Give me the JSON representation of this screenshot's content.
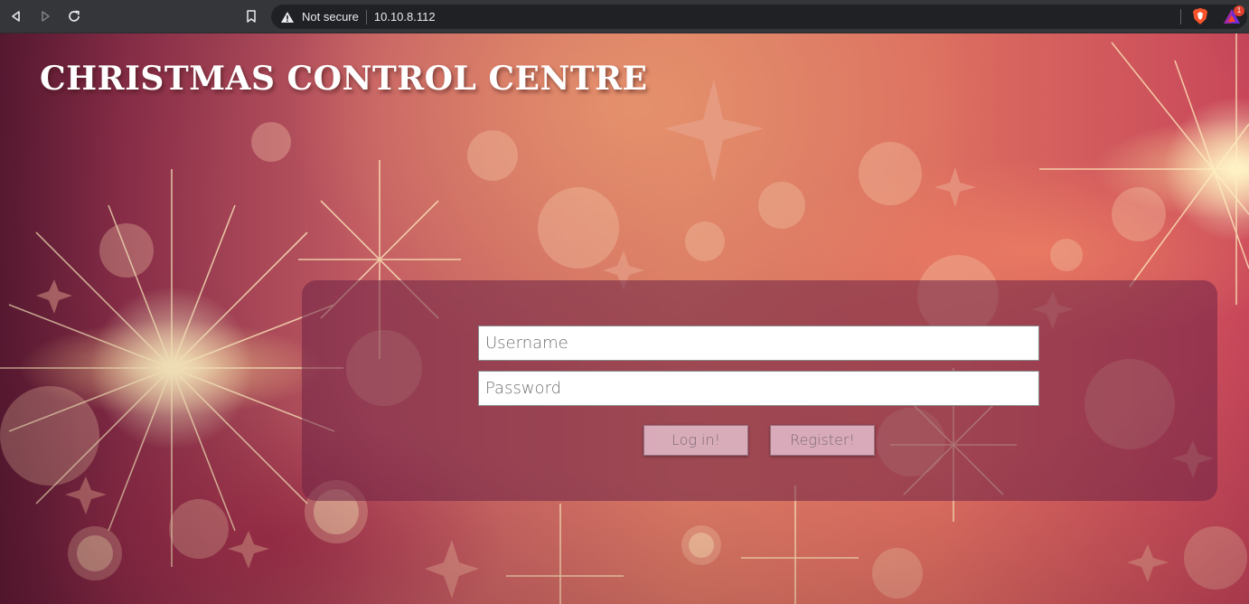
{
  "browser": {
    "security_label": "Not secure",
    "url": "10.10.8.112",
    "rewards_badge": "1",
    "icons": [
      "back-icon",
      "forward-icon",
      "reload-icon",
      "bookmark-icon",
      "warning-icon",
      "brave-shield-icon",
      "brave-rewards-icon"
    ]
  },
  "page": {
    "title": "CHRISTMAS CONTROL CENTRE",
    "login_form": {
      "username_placeholder": "Username",
      "password_placeholder": "Password",
      "login_label": "Log in!",
      "register_label": "Register!"
    }
  },
  "colors": {
    "chrome_bg": "#35363a",
    "omnibox_bg": "#202124",
    "panel_bg": "rgba(110,35,70,0.55)",
    "button_bg": "#e1b9c8",
    "title_color": "#ffffff"
  }
}
